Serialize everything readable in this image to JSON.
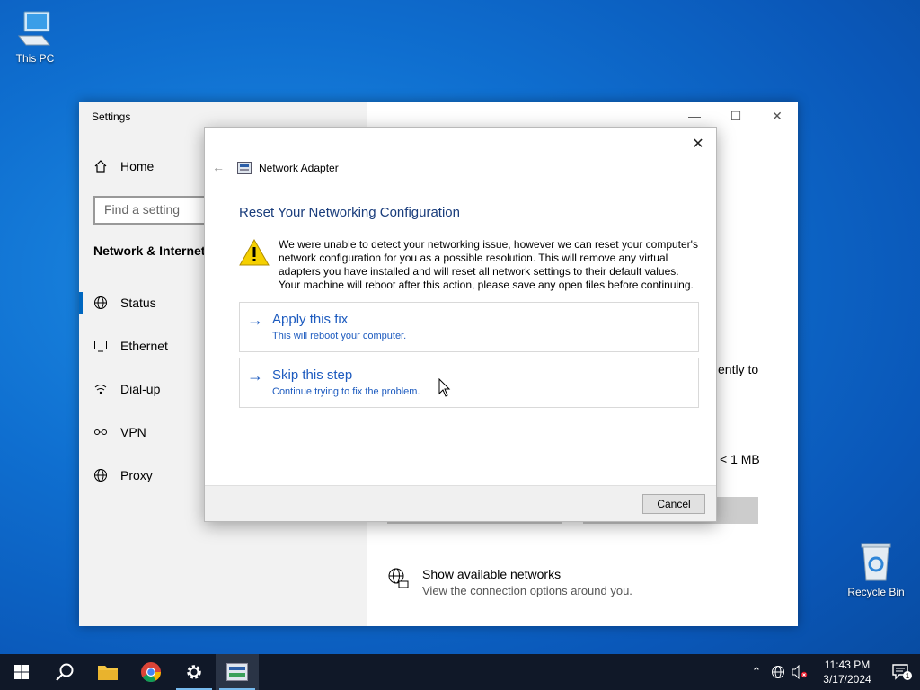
{
  "desktop": {
    "this_pc_label": "This PC",
    "recycle_bin_label": "Recycle Bin"
  },
  "settings": {
    "title": "Settings",
    "home_label": "Home",
    "search_placeholder": "Find a setting",
    "section_title": "Network & Internet",
    "nav_items": [
      {
        "label": "Status",
        "icon": "globe-icon"
      },
      {
        "label": "Ethernet",
        "icon": "monitor-icon"
      },
      {
        "label": "Dial-up",
        "icon": "dialup-icon"
      },
      {
        "label": "VPN",
        "icon": "vpn-icon"
      },
      {
        "label": "Proxy",
        "icon": "globe-icon"
      }
    ],
    "right_fragment_1": "ently to",
    "right_fragment_2": "< 1 MB",
    "show_networks_title": "Show available networks",
    "show_networks_sub": "View the connection options around you."
  },
  "dialog": {
    "app_name": "Network Adapter",
    "heading": "Reset Your Networking Configuration",
    "warning_text": "We were unable to detect your networking issue, however we can reset your computer's network configuration for you as a possible resolution. This will remove any virtual adapters you have installed and will reset all network settings to their default values. Your machine will reboot after this action, please save any open files before continuing.",
    "options": [
      {
        "title": "Apply this fix",
        "subtitle": "This will reboot your computer."
      },
      {
        "title": "Skip this step",
        "subtitle": "Continue trying to fix the problem."
      }
    ],
    "cancel_label": "Cancel"
  },
  "taskbar": {
    "time": "11:43 PM",
    "date": "3/17/2024",
    "notification_count": "1"
  },
  "colors": {
    "accent": "#0067c0",
    "link_blue": "#1d5bbf",
    "heading_blue": "#1a3d7c",
    "taskbar": "#101828"
  }
}
